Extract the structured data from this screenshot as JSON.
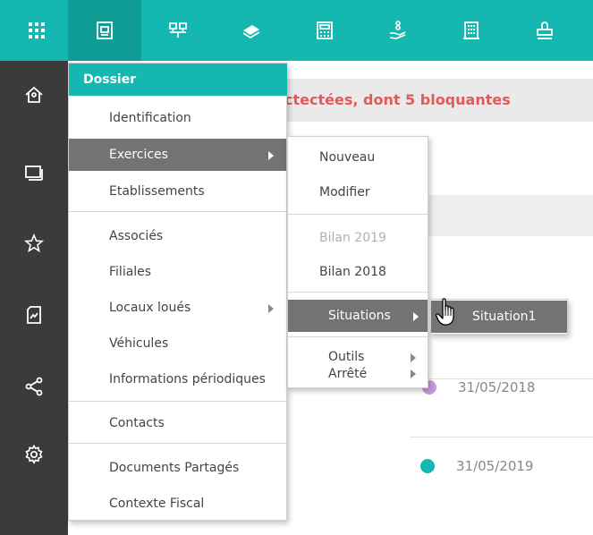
{
  "topbar": {
    "icons": [
      "apps-grid-icon",
      "folder-icon",
      "network-icon",
      "money-icon",
      "calculator-icon",
      "coins-hand-icon",
      "building-icon",
      "stamp-icon"
    ]
  },
  "sidebar": {
    "icons": [
      "home-icon",
      "windows-icon",
      "star-icon",
      "report-icon",
      "share-icon",
      "settings-icon"
    ]
  },
  "background": {
    "alert": "ctectées, dont 5 bloquantes",
    "rows": [
      {
        "date": "31/05/2018",
        "dot_color": "#c99ce0"
      },
      {
        "date": "31/05/2019",
        "dot_color": "#14b8b1"
      }
    ]
  },
  "dossier_menu": {
    "header": "Dossier",
    "items": [
      {
        "label": "Identification",
        "arrow": false,
        "highlighted": false
      },
      {
        "label": "Exercices",
        "arrow": true,
        "highlighted": true
      },
      {
        "label": "Etablissements",
        "arrow": false,
        "highlighted": false
      },
      {
        "label": "Associés",
        "arrow": false,
        "highlighted": false
      },
      {
        "label": "Filiales",
        "arrow": false,
        "highlighted": false
      },
      {
        "label": "Locaux loués",
        "arrow": true,
        "highlighted": false
      },
      {
        "label": "Véhicules",
        "arrow": false,
        "highlighted": false
      },
      {
        "label": "Informations périodiques",
        "arrow": false,
        "highlighted": false
      },
      {
        "label": "Contacts",
        "arrow": false,
        "highlighted": false
      },
      {
        "label": "Documents Partagés",
        "arrow": false,
        "highlighted": false
      },
      {
        "label": "Contexte Fiscal",
        "arrow": false,
        "highlighted": false
      }
    ]
  },
  "exercices_menu": {
    "items": [
      {
        "label": "Nouveau",
        "arrow": false,
        "disabled": false,
        "highlighted": false
      },
      {
        "label": "Modifier",
        "arrow": false,
        "disabled": false,
        "highlighted": false
      },
      {
        "label": "Bilan 2019",
        "arrow": false,
        "disabled": true,
        "highlighted": false
      },
      {
        "label": "Bilan 2018",
        "arrow": false,
        "disabled": false,
        "highlighted": false
      },
      {
        "label": "Situations",
        "arrow": true,
        "disabled": false,
        "highlighted": true
      },
      {
        "label": "Outils",
        "arrow": true,
        "disabled": false,
        "highlighted": false
      },
      {
        "label": "Arrêté",
        "arrow": true,
        "disabled": false,
        "highlighted": false
      }
    ]
  },
  "situations_menu": {
    "items": [
      {
        "label": "Situation1",
        "highlighted": true
      }
    ]
  },
  "colors": {
    "teal": "#14b8b1",
    "rail": "#3b3b3b",
    "highlight": "#737373",
    "alert": "#e4585a"
  }
}
